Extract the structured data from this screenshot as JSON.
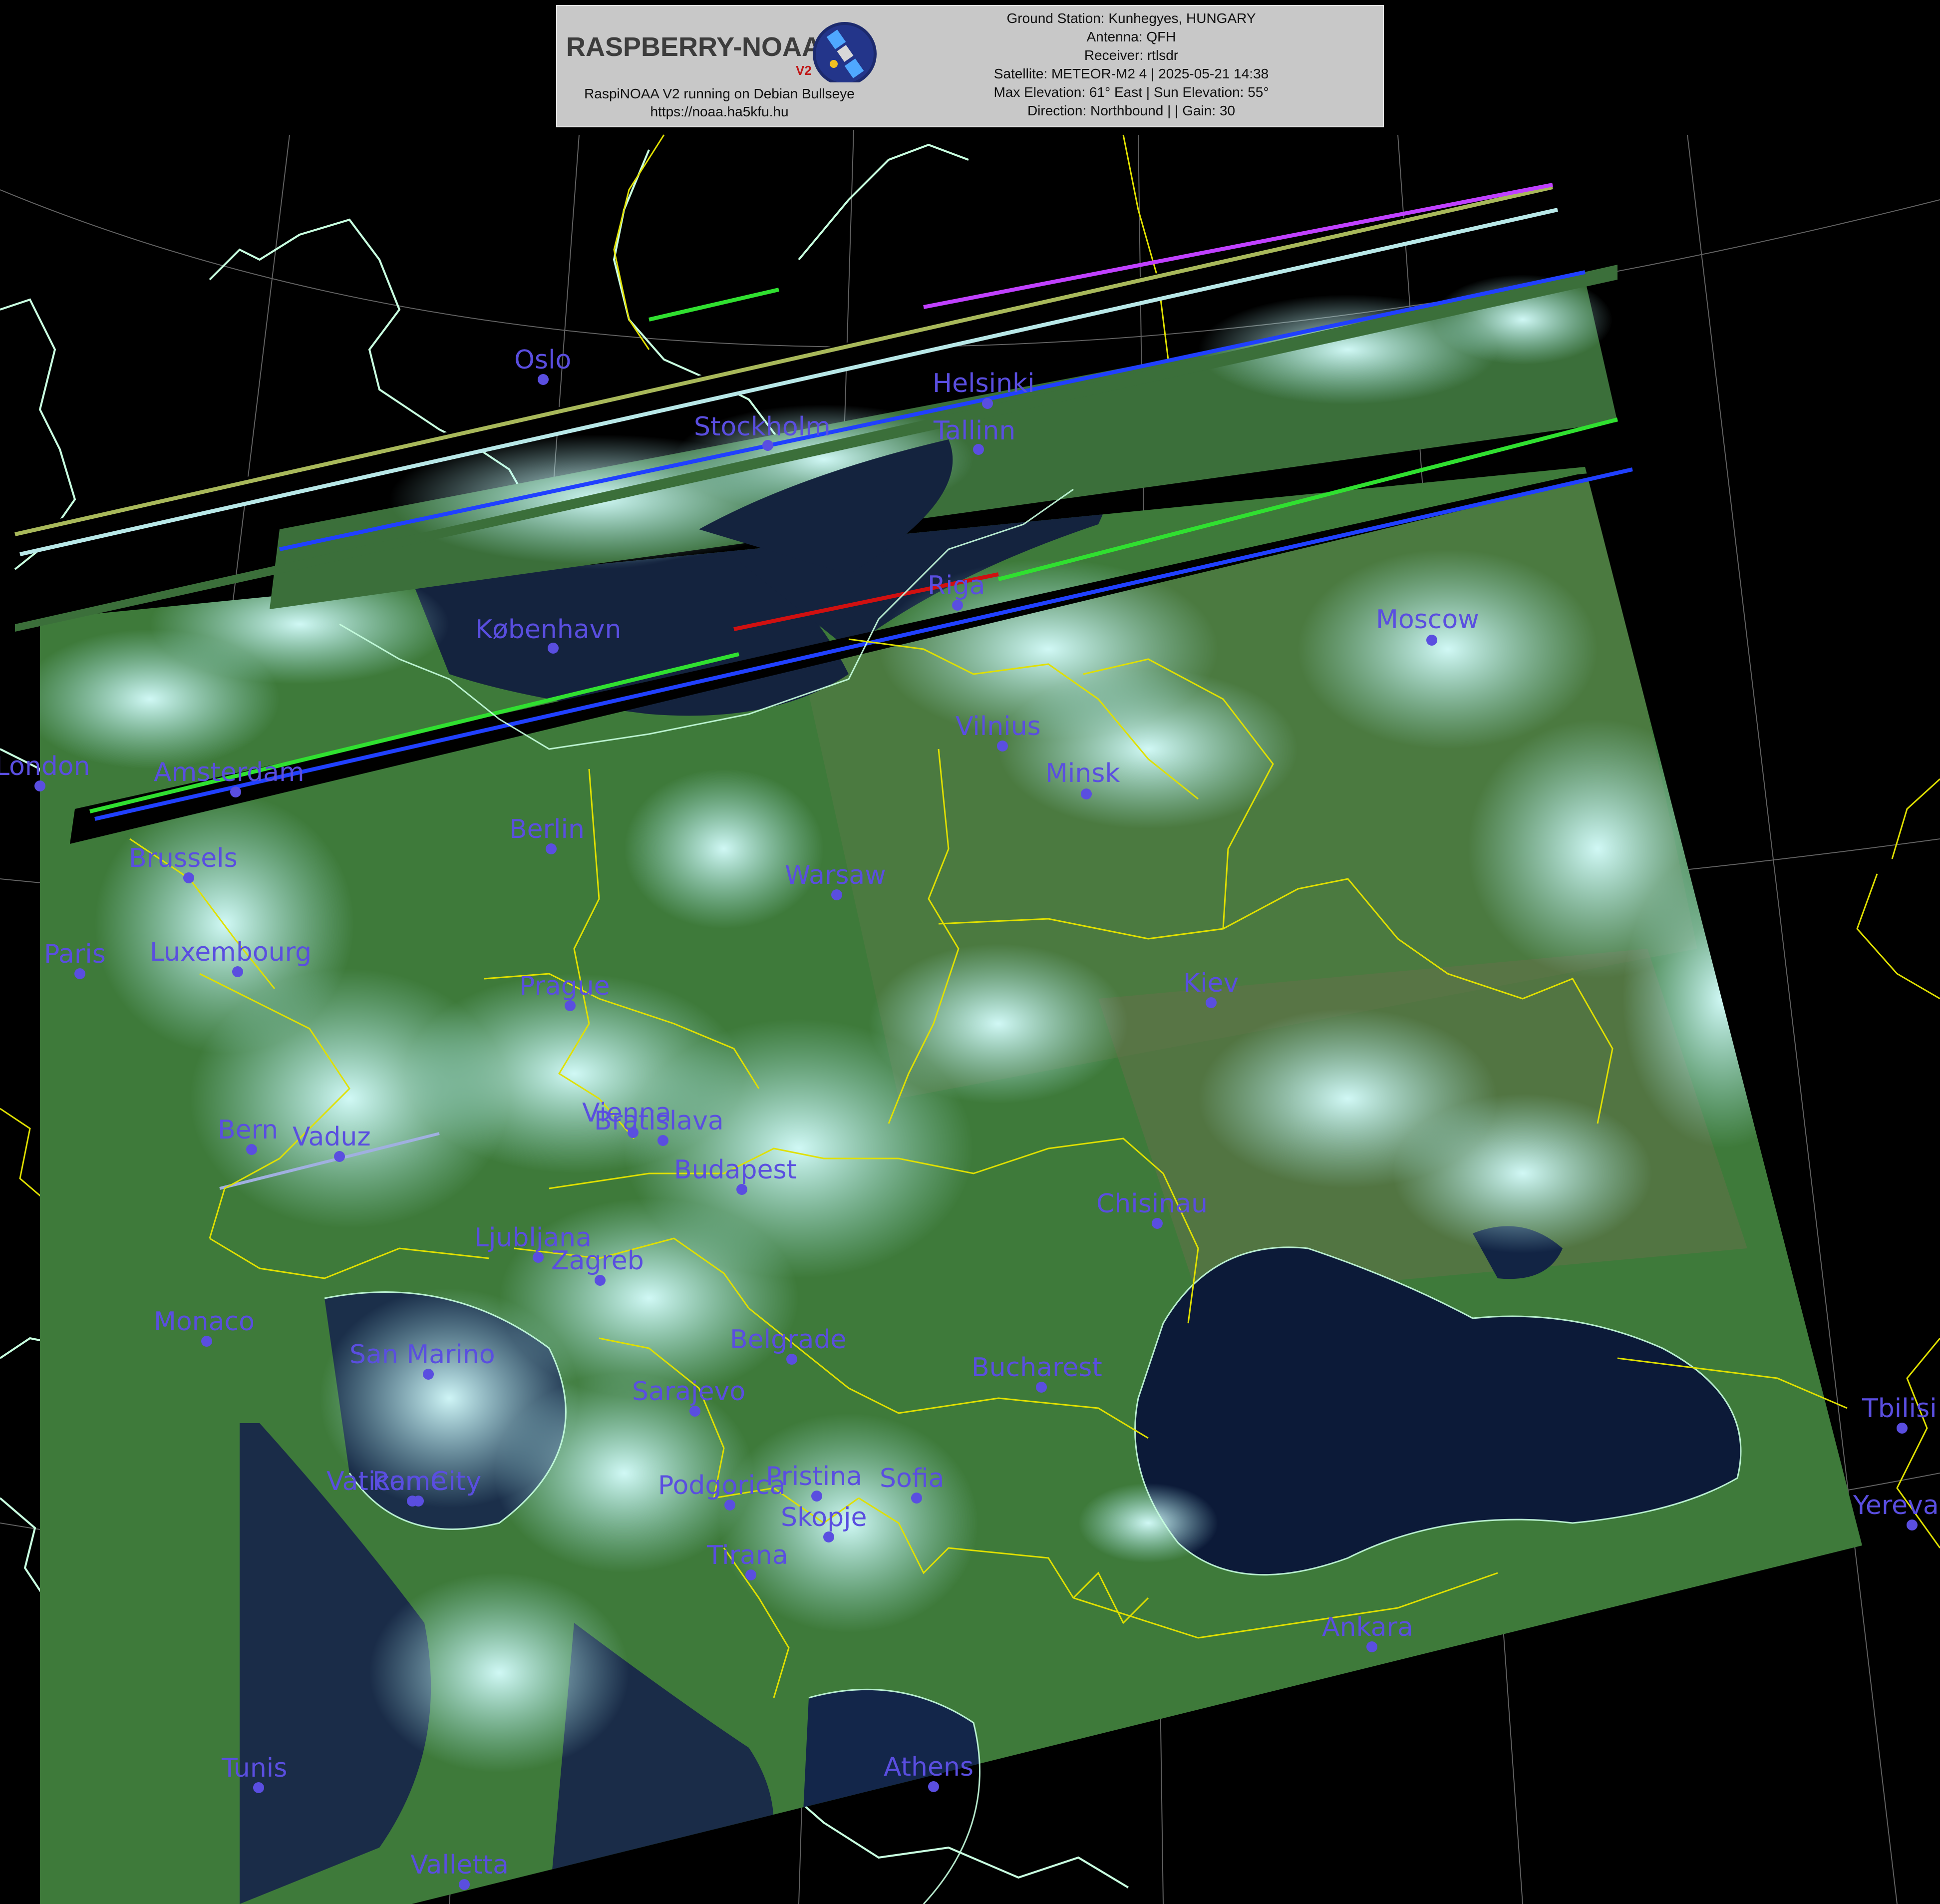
{
  "header": {
    "logo_text": "RASPBERRY-NOAA",
    "logo_version": "V2",
    "software_line": "RaspiNOAA V2 running on Debian Bullseye",
    "url_line": "https://noaa.ha5kfu.hu",
    "info_lines": [
      "Ground Station: Kunhegyes, HUNGARY",
      "Antenna: QFH",
      "Receiver: rtlsdr",
      "Satellite: METEOR-M2 4 | 2025-05-21 14:38",
      "Max Elevation: 61° East | Sun Elevation: 55°",
      "Direction: Northbound | | Gain: 30"
    ]
  },
  "colors": {
    "city_label": "#5a4ee0",
    "border_line": "#e0e000",
    "coastline": "#c8ffe0",
    "graticule": "#8a8a8a",
    "land": "#3e7a3a",
    "cloud": "#bff2f2",
    "sea": "#0c1a38"
  },
  "cities": [
    "Oslo",
    "Stockholm",
    "Helsinki",
    "Tallinn",
    "Riga",
    "København",
    "Moscow",
    "Vilnius",
    "Minsk",
    "London",
    "Amsterdam",
    "Berlin",
    "Brussels",
    "Warsaw",
    "Paris",
    "Luxembourg",
    "Prague",
    "Kiev",
    "Vienna",
    "Bratislava",
    "Bern",
    "Vaduz",
    "Budapest",
    "Chisinau",
    "Ljubljana",
    "Zagreb",
    "Monaco",
    "San Marino",
    "Belgrade",
    "Bucharest",
    "Sarajevo",
    "Tbilisi",
    "Vatican City",
    "Rome",
    "Podgorica",
    "Pristina",
    "Sofia",
    "Skopje",
    "Yerevan",
    "Tirana",
    "Ankara",
    "Tunis",
    "Athens",
    "Valletta"
  ]
}
